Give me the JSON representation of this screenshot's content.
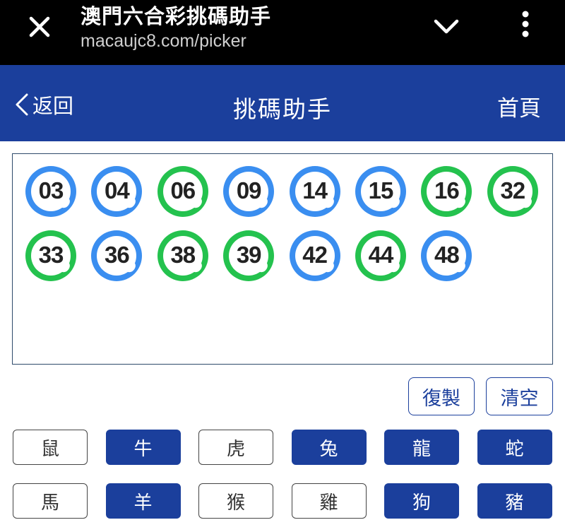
{
  "browser": {
    "title": "澳門六合彩挑碼助手",
    "url": "macaujc8.com/picker"
  },
  "header": {
    "back_label": "返回",
    "title": "挑碼助手",
    "home_label": "首頁"
  },
  "colors": {
    "blue_ball": "#3a8ef0",
    "green_ball": "#24c24e",
    "header_bg": "#1b3f9c"
  },
  "balls": [
    {
      "number": "03",
      "color": "blue"
    },
    {
      "number": "04",
      "color": "blue"
    },
    {
      "number": "06",
      "color": "green"
    },
    {
      "number": "09",
      "color": "blue"
    },
    {
      "number": "14",
      "color": "blue"
    },
    {
      "number": "15",
      "color": "blue"
    },
    {
      "number": "16",
      "color": "green"
    },
    {
      "number": "32",
      "color": "green"
    },
    {
      "number": "33",
      "color": "green"
    },
    {
      "number": "36",
      "color": "blue"
    },
    {
      "number": "38",
      "color": "green"
    },
    {
      "number": "39",
      "color": "green"
    },
    {
      "number": "42",
      "color": "blue"
    },
    {
      "number": "44",
      "color": "green"
    },
    {
      "number": "48",
      "color": "blue"
    }
  ],
  "actions": {
    "copy_label": "復製",
    "clear_label": "清空"
  },
  "zodiacs": [
    {
      "label": "鼠",
      "selected": false
    },
    {
      "label": "牛",
      "selected": true
    },
    {
      "label": "虎",
      "selected": false
    },
    {
      "label": "兔",
      "selected": true
    },
    {
      "label": "龍",
      "selected": true
    },
    {
      "label": "蛇",
      "selected": true
    },
    {
      "label": "馬",
      "selected": false
    },
    {
      "label": "羊",
      "selected": true
    },
    {
      "label": "猴",
      "selected": false
    },
    {
      "label": "雞",
      "selected": false
    },
    {
      "label": "狗",
      "selected": true
    },
    {
      "label": "豬",
      "selected": true
    }
  ]
}
